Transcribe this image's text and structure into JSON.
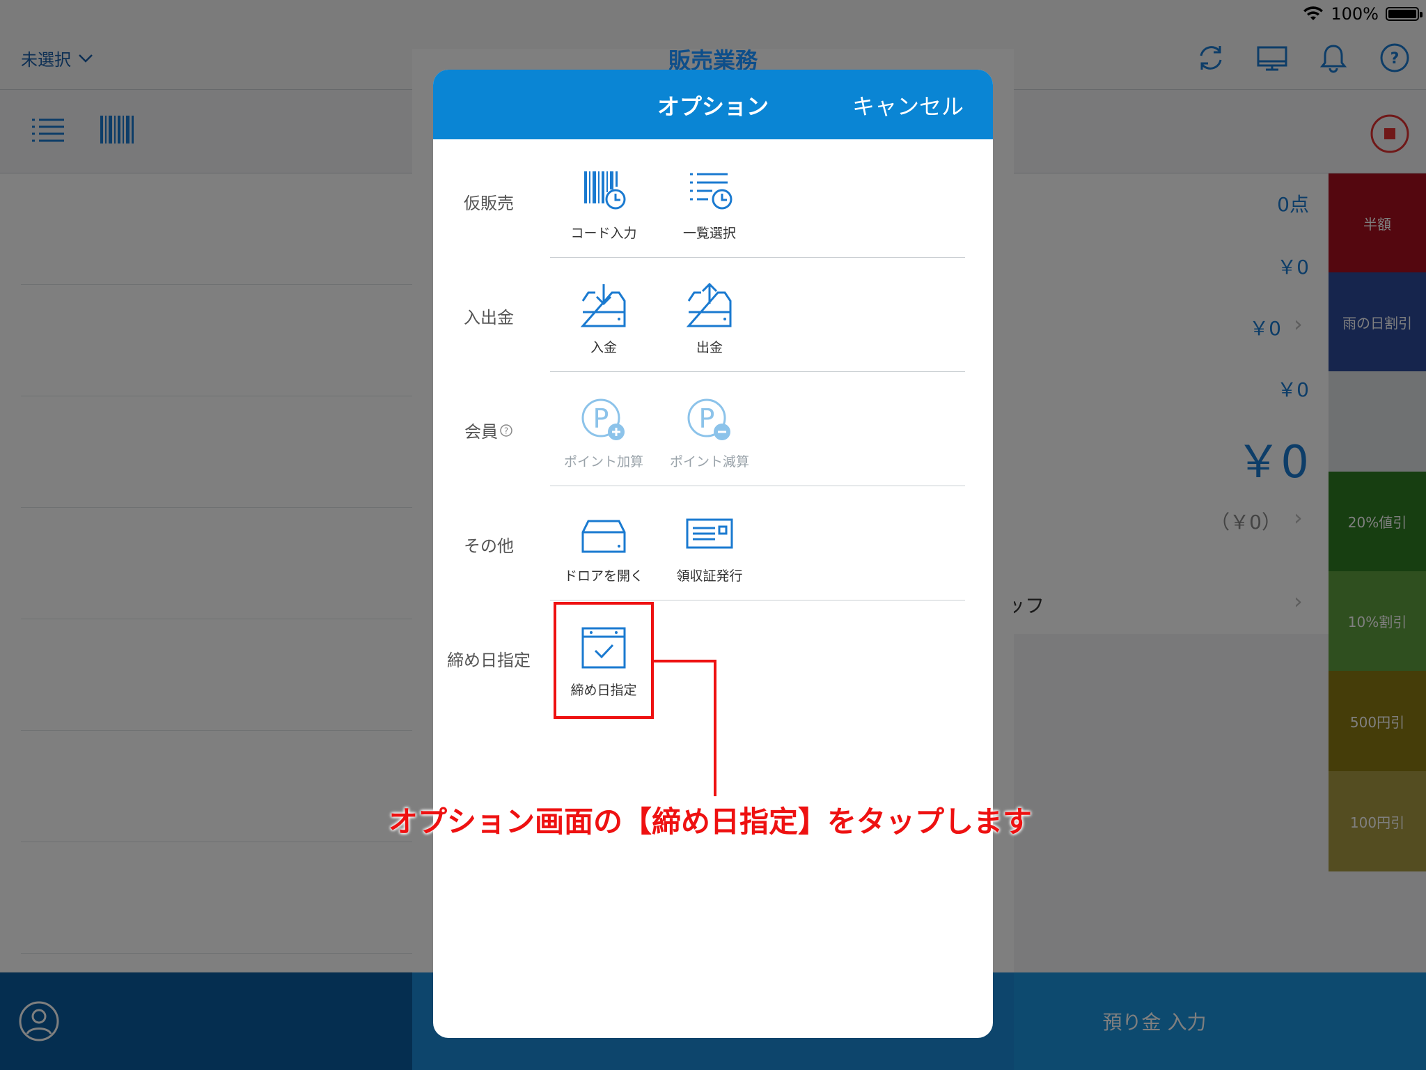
{
  "status": {
    "battery_percent": "100%"
  },
  "nav": {
    "store_select": "未選択",
    "title": "販売業務"
  },
  "register": {
    "count": "0点",
    "subtotal": "￥0",
    "discount": "￥0",
    "tax": "￥0",
    "total": "￥0",
    "tax_included": "（￥0）",
    "staff_label": "タッフ",
    "deposit_button": "預り金 入力"
  },
  "side_buttons": [
    {
      "label": "半額",
      "color": "#a80f1e"
    },
    {
      "label": "雨の日割引",
      "color": "#2d4a9a"
    },
    {
      "label": "",
      "color": "#dfe2e5"
    },
    {
      "label": "20%値引",
      "color": "#2e7d23"
    },
    {
      "label": "10%割引",
      "color": "#5f9e3e"
    },
    {
      "label": "500円引",
      "color": "#8a7a12"
    },
    {
      "label": "100円引",
      "color": "#a99a42"
    }
  ],
  "modal": {
    "title": "オプション",
    "cancel": "キャンセル",
    "sections": [
      {
        "label": "仮販売",
        "options": [
          {
            "label": "コード入力",
            "icon": "barcode-clock-icon"
          },
          {
            "label": "一覧選択",
            "icon": "list-clock-icon"
          }
        ]
      },
      {
        "label": "入出金",
        "options": [
          {
            "label": "入金",
            "icon": "tray-in-icon"
          },
          {
            "label": "出金",
            "icon": "tray-out-icon"
          }
        ]
      },
      {
        "label": "会員",
        "options": [
          {
            "label": "ポイント加算",
            "icon": "point-plus-icon"
          },
          {
            "label": "ポイント減算",
            "icon": "point-minus-icon"
          }
        ]
      },
      {
        "label": "その他",
        "options": [
          {
            "label": "ドロアを開く",
            "icon": "drawer-icon"
          },
          {
            "label": "領収証発行",
            "icon": "receipt-icon"
          }
        ]
      },
      {
        "label": "締め日指定",
        "options": [
          {
            "label": "締め日指定",
            "icon": "calendar-check-icon"
          }
        ]
      }
    ]
  },
  "annotation": "オプション画面の【締め日指定】をタップします"
}
